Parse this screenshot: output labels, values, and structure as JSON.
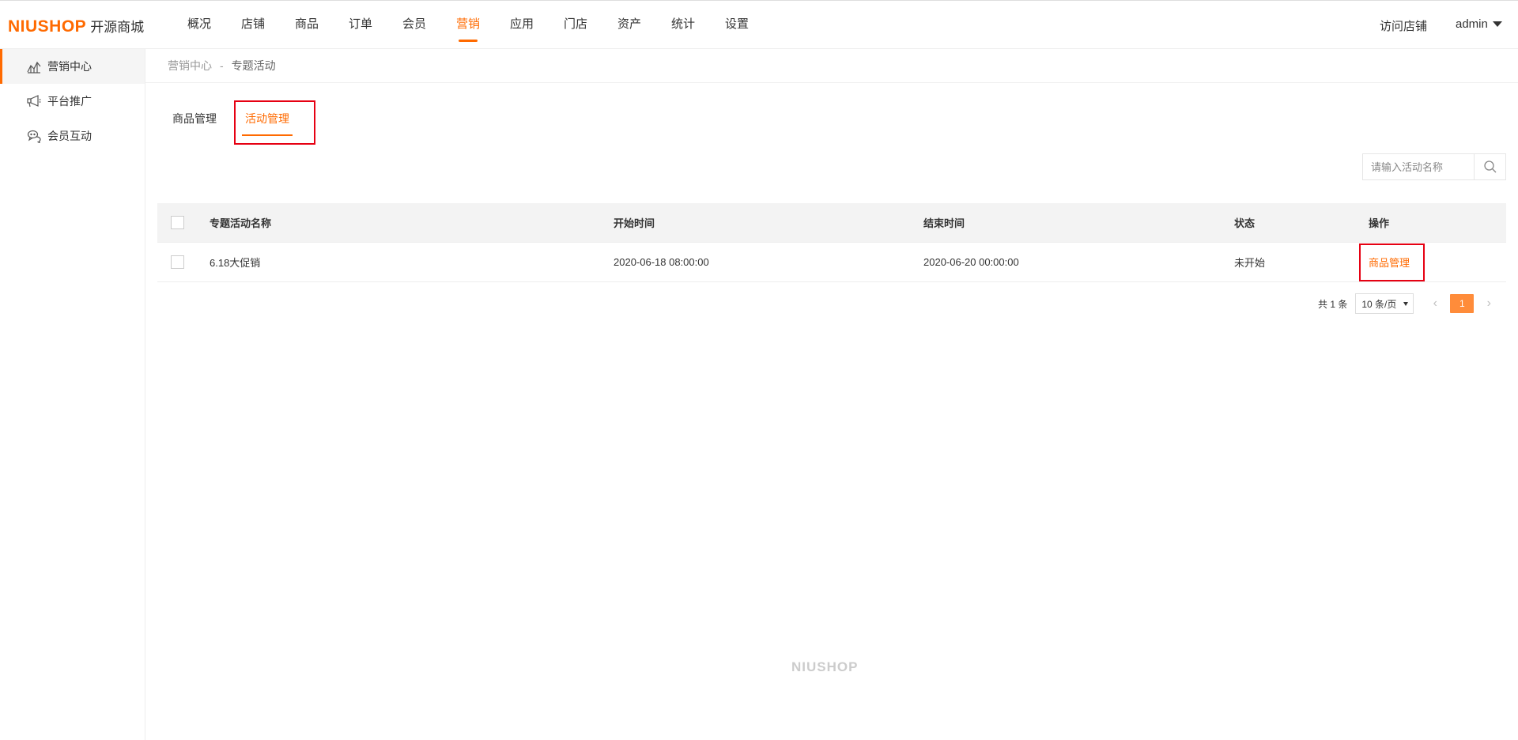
{
  "header": {
    "logo_brand": "NIUSHOP",
    "logo_sub": "开源商城",
    "nav": [
      "概况",
      "店铺",
      "商品",
      "订单",
      "会员",
      "营销",
      "应用",
      "门店",
      "资产",
      "统计",
      "设置"
    ],
    "active_nav": "营销",
    "visit_store": "访问店铺",
    "user": "admin"
  },
  "sidebar": {
    "items": [
      {
        "label": "营销中心",
        "icon": "chart-icon",
        "active": true
      },
      {
        "label": "平台推广",
        "icon": "megaphone-icon",
        "active": false
      },
      {
        "label": "会员互动",
        "icon": "chat-icon",
        "active": false
      }
    ]
  },
  "breadcrumb": {
    "parent": "营销中心",
    "separator": "-",
    "current": "专题活动"
  },
  "tabs": {
    "goods": "商品管理",
    "activity": "活动管理"
  },
  "search": {
    "placeholder": "请输入活动名称"
  },
  "table": {
    "headers": {
      "name": "专题活动名称",
      "start": "开始时间",
      "end": "结束时间",
      "status": "状态",
      "op": "操作"
    },
    "rows": [
      {
        "name": "6.18大促销",
        "start": "2020-06-18 08:00:00",
        "end": "2020-06-20 00:00:00",
        "status": "未开始",
        "op": "商品管理"
      }
    ]
  },
  "pagination": {
    "total": "共 1 条",
    "page_size": "10 条/页",
    "current": "1"
  },
  "footer": {
    "logo": "NIUSHOP"
  },
  "colors": {
    "accent": "#ff6a00",
    "highlight_box": "#e60012"
  }
}
